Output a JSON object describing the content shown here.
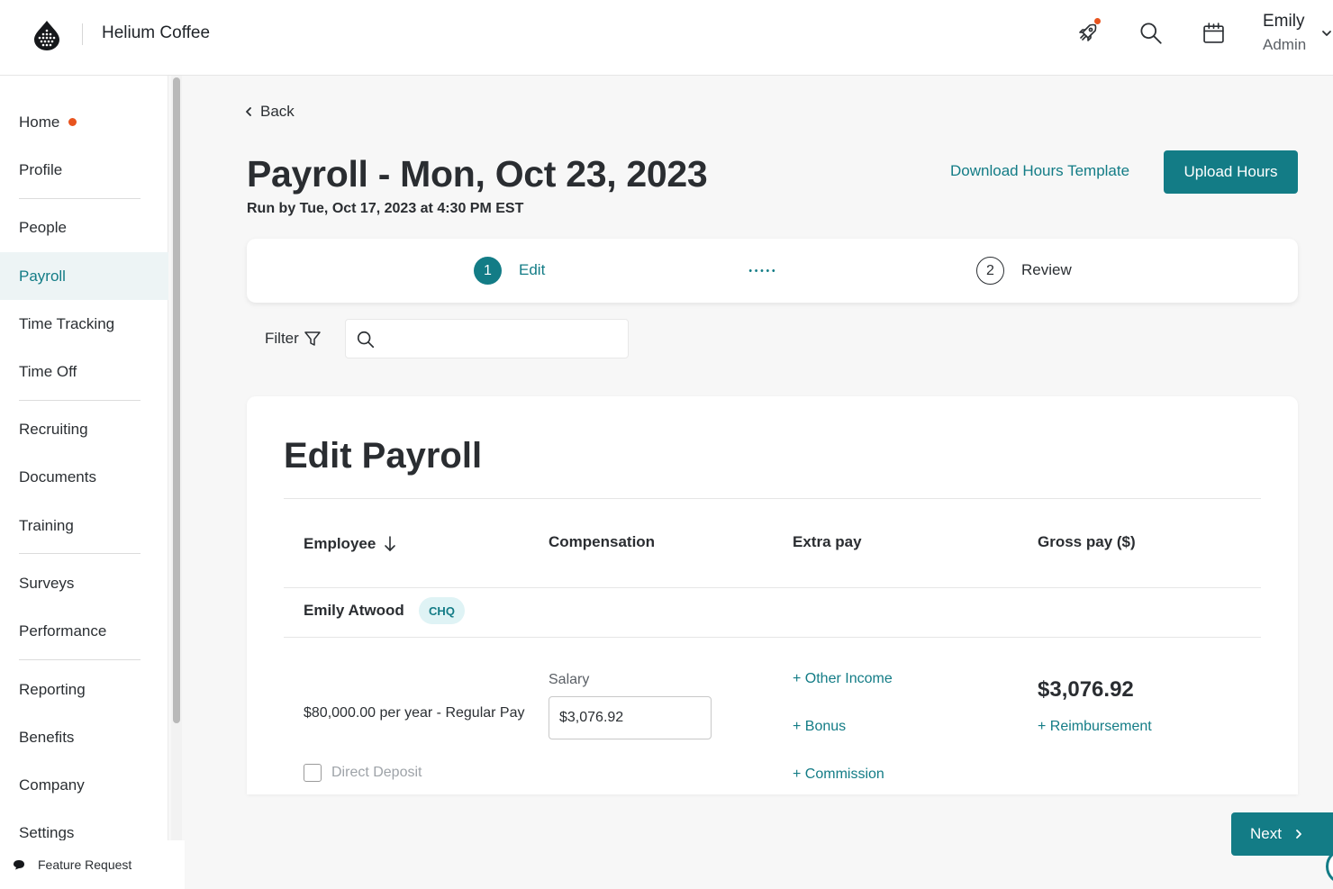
{
  "header": {
    "company_name": "Helium Coffee",
    "user_name": "Emily",
    "user_role": "Admin",
    "icons": [
      "droplet-logo-icon",
      "rocket-icon",
      "search-icon",
      "calendar-icon",
      "chevron-down-icon"
    ]
  },
  "sidebar": {
    "items": [
      {
        "label": "Home",
        "has_dot": true
      },
      {
        "label": "Profile"
      },
      {
        "label": "People"
      },
      {
        "label": "Payroll",
        "active": true
      },
      {
        "label": "Time Tracking"
      },
      {
        "label": "Time Off"
      },
      {
        "label": "Recruiting"
      },
      {
        "label": "Documents"
      },
      {
        "label": "Training"
      },
      {
        "label": "Surveys"
      },
      {
        "label": "Performance"
      },
      {
        "label": "Reporting"
      },
      {
        "label": "Benefits"
      },
      {
        "label": "Company"
      },
      {
        "label": "Settings"
      }
    ],
    "feature_request": "Feature Request"
  },
  "main": {
    "back_label": "Back",
    "title": "Payroll - Mon, Oct 23, 2023",
    "run_by": "Run by Tue, Oct 17, 2023 at 4:30 PM EST",
    "download_template": "Download Hours Template",
    "upload_hours": "Upload Hours",
    "stepper": {
      "step1_number": "1",
      "step1_label": "Edit",
      "step2_number": "2",
      "step2_label": "Review"
    },
    "filter_label": "Filter",
    "search": {
      "value": "",
      "placeholder": ""
    }
  },
  "edit_payroll": {
    "title": "Edit Payroll",
    "columns": {
      "employee": "Employee",
      "compensation": "Compensation",
      "extra_pay": "Extra pay",
      "gross_pay": "Gross pay ($)"
    },
    "employee": {
      "name": "Emily Atwood",
      "badge": "CHQ",
      "pay_description": "$80,000.00 per year - Regular Pay",
      "salary_label": "Salary",
      "salary_value": "$3,076.92",
      "direct_deposit_label": "Direct Deposit",
      "direct_deposit_checked": false,
      "other_income": "+ Other Income",
      "bonus": "+ Bonus",
      "commission": "+ Commission",
      "gross_pay": "$3,076.92",
      "reimbursement": "+ Reimbursement"
    }
  },
  "footer": {
    "next_label": "Next"
  },
  "colors": {
    "brand": "#137c86",
    "notification": "#e8541f",
    "badge_bg": "#dff3f5",
    "active_nav_bg": "#edf4f5"
  }
}
